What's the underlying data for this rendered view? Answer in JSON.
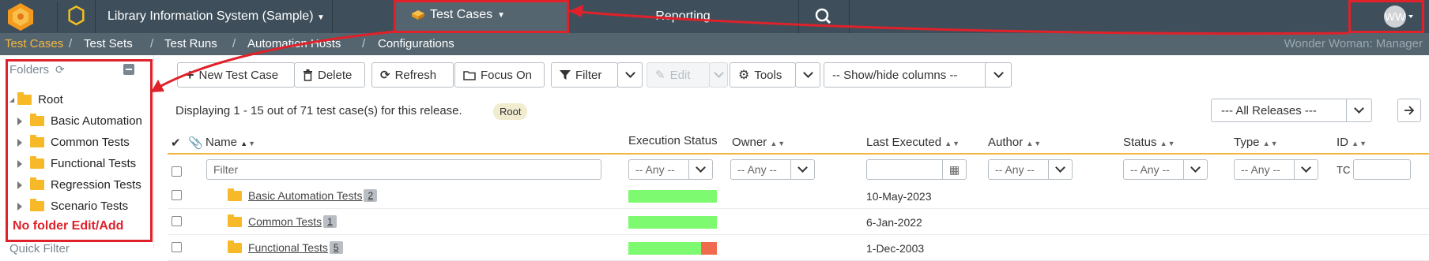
{
  "topbar": {
    "project": "Library Information System (Sample)",
    "active_tab": "Test Cases",
    "reporting": "Reporting",
    "avatar_initials": "WW"
  },
  "breadcrumbs": {
    "items": [
      "Test Cases",
      "Test Sets",
      "Test Runs",
      "Automation Hosts",
      "Configurations"
    ],
    "user": "Wonder Woman: Manager"
  },
  "folders": {
    "title": "Folders",
    "root": "Root",
    "children": [
      "Basic Automation",
      "Common Tests",
      "Functional Tests",
      "Regression Tests",
      "Scenario Tests"
    ],
    "annotation": "No folder Edit/Add",
    "next_panel": "Quick Filter"
  },
  "toolbar": {
    "new": "New Test Case",
    "delete": "Delete",
    "refresh": "Refresh",
    "focus": "Focus On",
    "filter": "Filter",
    "edit": "Edit",
    "tools": "Tools",
    "columns": "-- Show/hide columns --"
  },
  "summary": {
    "message": "Displaying 1 - 15 out of 71 test case(s) for this release.",
    "badge": "Root",
    "release": "--- All Releases ---"
  },
  "grid": {
    "columns": {
      "name": "Name",
      "execution": "Execution Status",
      "owner": "Owner",
      "last_executed": "Last Executed",
      "author": "Author",
      "status": "Status",
      "type": "Type",
      "id": "ID"
    },
    "filters": {
      "name_placeholder": "Filter",
      "any": "-- Any --",
      "id_prefix": "TC"
    },
    "rows": [
      {
        "name": "Basic Automation Tests",
        "count": "2",
        "date": "10-May-2023",
        "pass_fraction": 1.0,
        "fail_fraction": 0
      },
      {
        "name": "Common Tests",
        "count": "1",
        "date": "6-Jan-2022",
        "pass_fraction": 1.0,
        "fail_fraction": 0
      },
      {
        "name": "Functional Tests",
        "count": "5",
        "date": "1-Dec-2003",
        "pass_fraction": 0.82,
        "fail_fraction": 0.18
      }
    ]
  },
  "colors": {
    "topbar": "#3e4f5b",
    "crumbbar": "#55656f",
    "accent": "#f4b740",
    "annotation": "#e0212a",
    "pass": "#7dfa6f",
    "fail": "#f06a4d"
  }
}
